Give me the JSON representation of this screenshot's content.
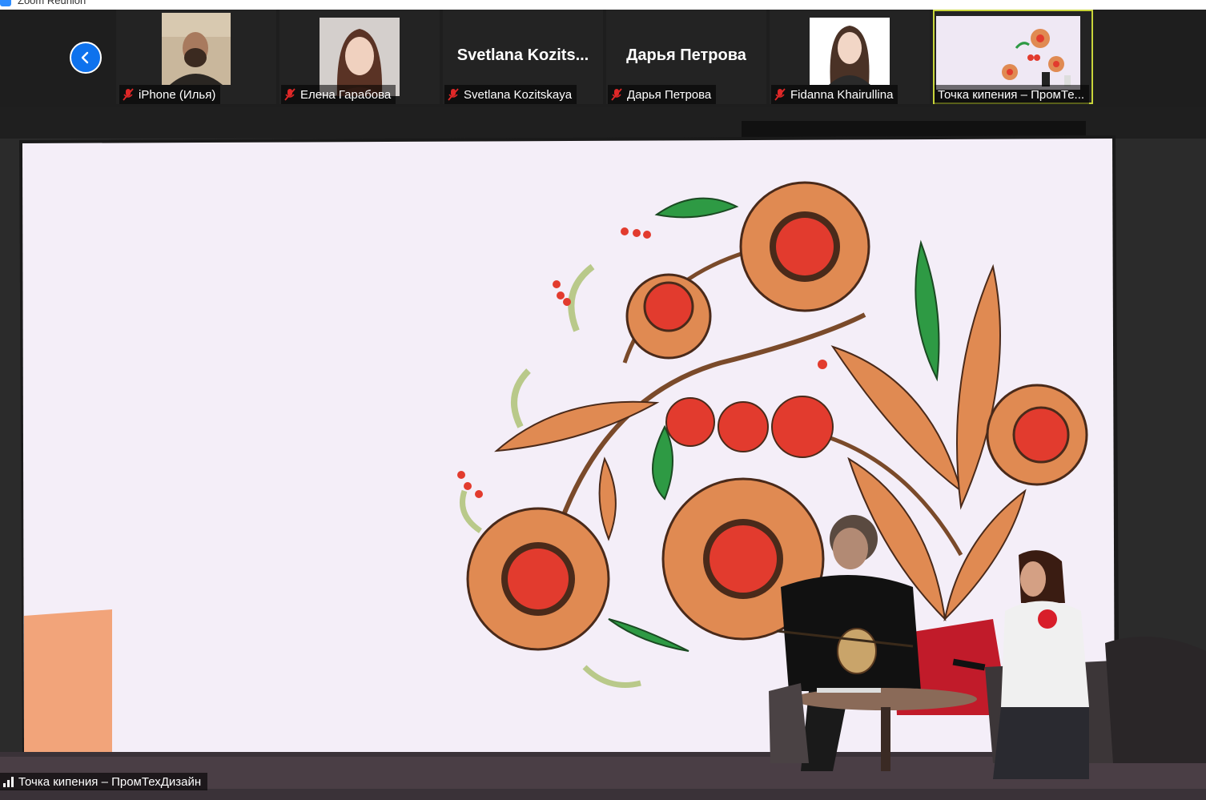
{
  "window": {
    "title": "Zoom Reunion"
  },
  "strip": {
    "participants": [
      {
        "label": "iPhone (Илья)",
        "display_name": "",
        "muted": true
      },
      {
        "label": "Елена Гарабова",
        "display_name": "",
        "muted": true
      },
      {
        "label": "Svetlana Kozitskaya",
        "display_name": "Svetlana  Kozits...",
        "muted": true
      },
      {
        "label": "Дарья Петрова",
        "display_name": "Дарья Петрова",
        "muted": true
      },
      {
        "label": "Fidanna Khairullina",
        "display_name": "",
        "muted": true
      },
      {
        "label": "Точка кипения – ПромТе...",
        "display_name": "",
        "muted": false,
        "active_speaker": true
      }
    ]
  },
  "main": {
    "speaker_label": "Точка кипения – ПромТехДизайн"
  },
  "colors": {
    "accent": "#0e72ed",
    "muted_mic": "#e02828",
    "active_border": "#c8d43a",
    "screen_bg": "#f4eef8",
    "petal": "#e08a52",
    "berry": "#e23b2e",
    "leaf": "#2e9a44"
  }
}
